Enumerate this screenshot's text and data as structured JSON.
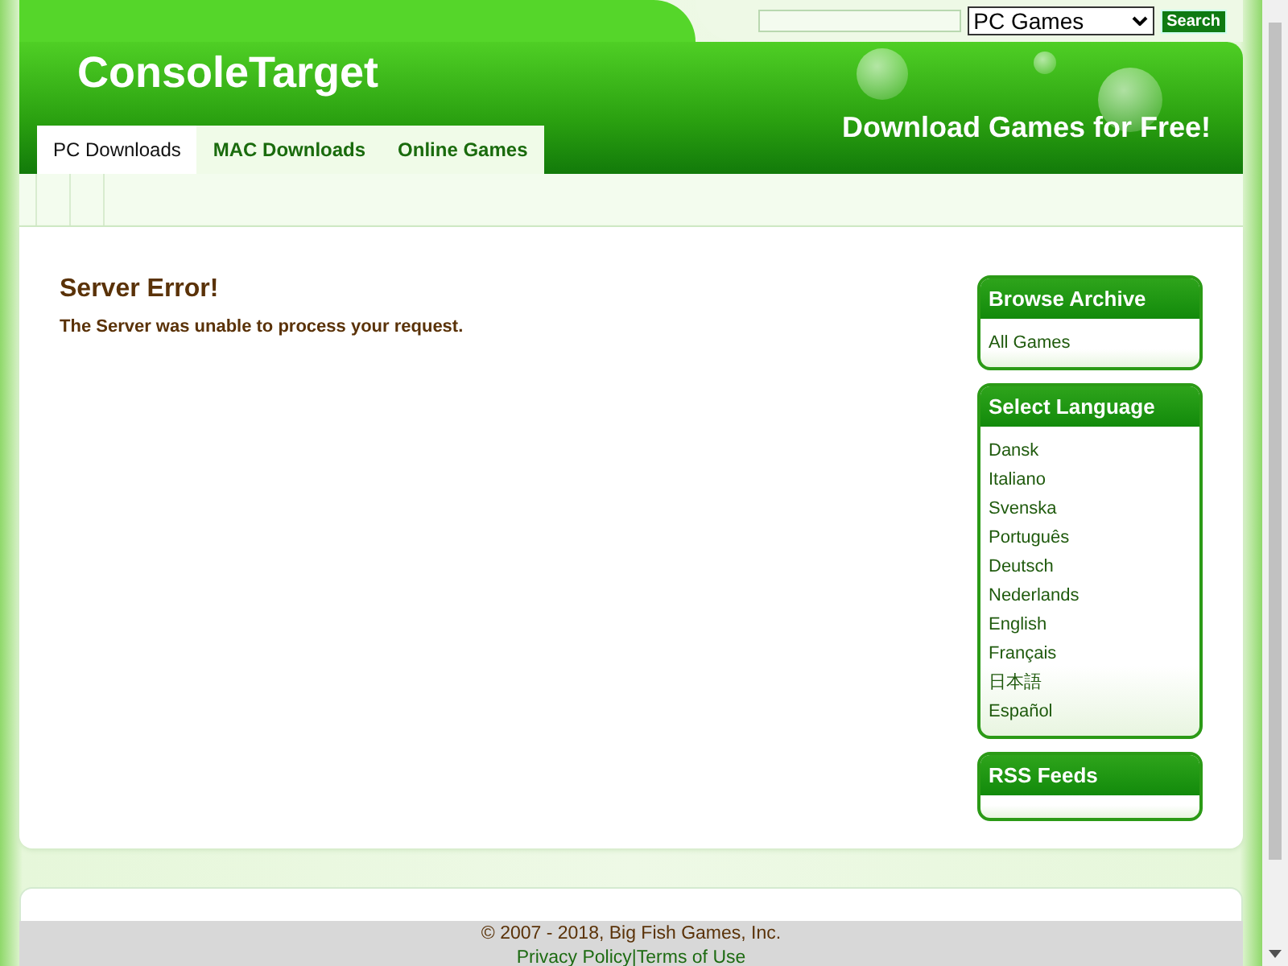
{
  "search": {
    "category": "PC Games",
    "button": "Search"
  },
  "header": {
    "logo": "ConsoleTarget",
    "tagline": "Download Games for Free!"
  },
  "tabs": [
    {
      "label": "PC Downloads",
      "selected": true
    },
    {
      "label": "MAC Downloads",
      "selected": false
    },
    {
      "label": "Online Games",
      "selected": false
    }
  ],
  "content": {
    "title": "Server Error!",
    "message": "The Server was unable to process your request."
  },
  "sidebar": [
    {
      "title": "Browse Archive",
      "items": [
        "All Games"
      ]
    },
    {
      "title": "Select Language",
      "items": [
        "Dansk",
        "Italiano",
        "Svenska",
        "Português",
        "Deutsch",
        "Nederlands",
        "English",
        "Français",
        "日本語",
        "Español"
      ]
    },
    {
      "title": "RSS Feeds"
    }
  ],
  "footer": {
    "copyright": "© 2007 - 2018, Big Fish Games, Inc.",
    "links": [
      "Privacy Policy",
      "Terms of Use"
    ],
    "separator": "|"
  }
}
